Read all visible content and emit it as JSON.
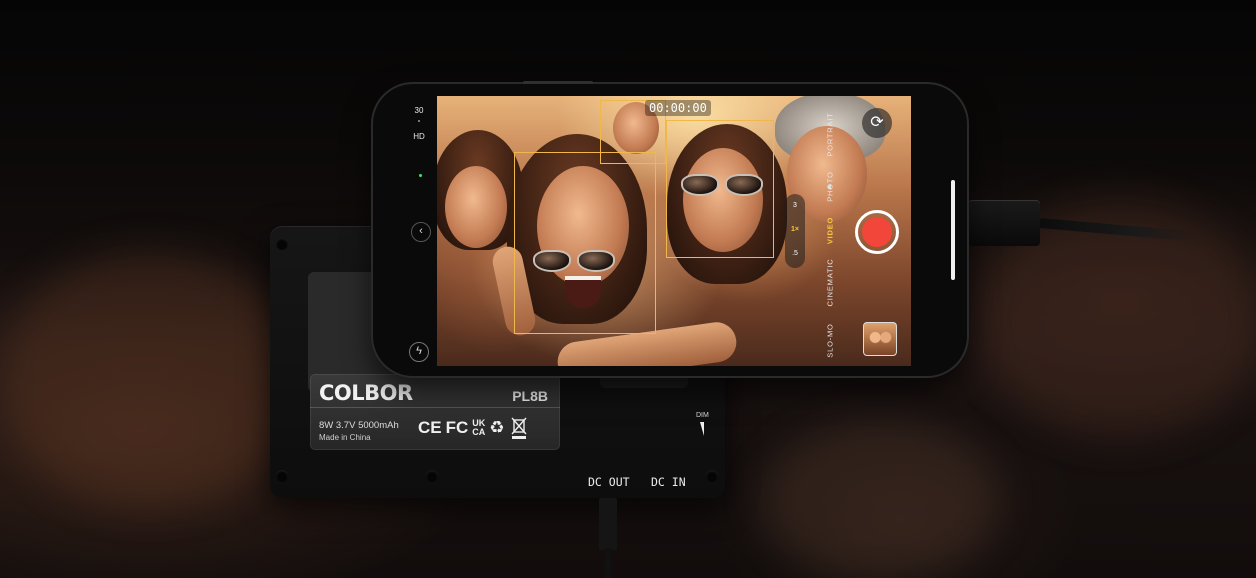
{
  "camera": {
    "frame_rate": "30",
    "resolution": "HD",
    "timer": "00:00:00",
    "zoom_options": [
      "3",
      "1×",
      ".5"
    ],
    "zoom_selected": "1×",
    "modes": [
      "PORTRAIT",
      "PHOTO",
      "VIDEO",
      "CINEMATIC",
      "SLO-MO"
    ],
    "mode_selected": "VIDEO",
    "icons": {
      "flip": "camera-flip-icon",
      "back": "chevron-left-icon",
      "flash": "flash-off-icon",
      "shutter": "record-button"
    },
    "record_color": "#f2463a",
    "selection_color": "#f6c944"
  },
  "device_label": {
    "brand": "COLBOR",
    "model": "PL8B",
    "spec": "8W  3.7V  5000mAh",
    "origin": "Made in China",
    "cert_ce": "CE",
    "cert_fc": "FC",
    "cert_ukca_top": "UK",
    "cert_ukca_bottom": "CA"
  },
  "ports": {
    "dc_out": "DC OUT",
    "dc_in": "DC IN",
    "dim": "DIM"
  }
}
